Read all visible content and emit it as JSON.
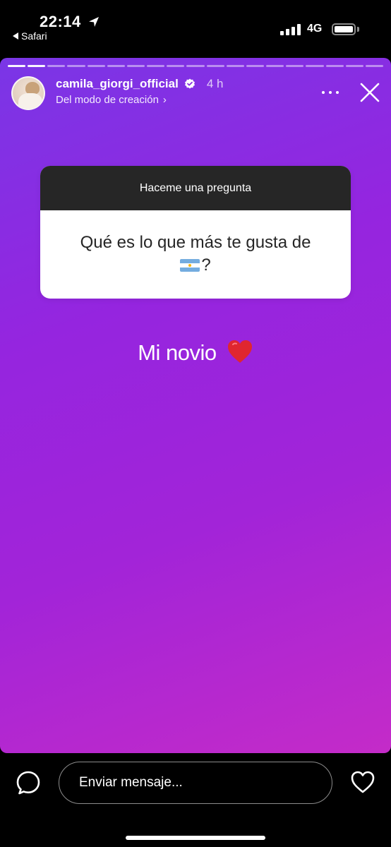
{
  "status_bar": {
    "time": "22:14",
    "back_app": "Safari",
    "network": "4G",
    "icons": [
      "location-arrow-icon",
      "signal-bars-icon",
      "battery-icon"
    ]
  },
  "story": {
    "username": "camila_giorgi_official",
    "time_ago": "4 h",
    "subtitle": "Del modo de creación",
    "subtitle_chevron": "›",
    "progress": {
      "segments": 19,
      "viewed": 2
    },
    "question_sticker": {
      "header": "Haceme una pregunta",
      "question_line1": "Qué es lo que más te gusta de",
      "question_line2_suffix": "?",
      "question_emoji": "flag-argentina"
    },
    "answer_text": "Mi novio",
    "answer_emoji": "red-heart",
    "colors": {
      "gradient_top": "#7a36e6",
      "gradient_mid": "#a224d8",
      "gradient_bottom": "#c42bc8",
      "sticker_header": "#262626"
    }
  },
  "bottom_bar": {
    "message_placeholder": "Enviar mensaje..."
  }
}
